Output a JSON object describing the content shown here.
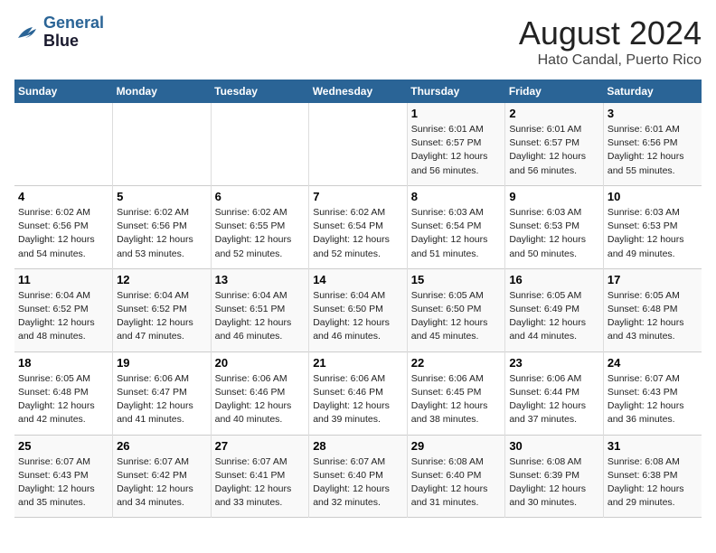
{
  "header": {
    "logo_line1": "General",
    "logo_line2": "Blue",
    "month": "August 2024",
    "location": "Hato Candal, Puerto Rico"
  },
  "weekdays": [
    "Sunday",
    "Monday",
    "Tuesday",
    "Wednesday",
    "Thursday",
    "Friday",
    "Saturday"
  ],
  "weeks": [
    [
      {
        "day": "",
        "info": ""
      },
      {
        "day": "",
        "info": ""
      },
      {
        "day": "",
        "info": ""
      },
      {
        "day": "",
        "info": ""
      },
      {
        "day": "1",
        "info": "Sunrise: 6:01 AM\nSunset: 6:57 PM\nDaylight: 12 hours\nand 56 minutes."
      },
      {
        "day": "2",
        "info": "Sunrise: 6:01 AM\nSunset: 6:57 PM\nDaylight: 12 hours\nand 56 minutes."
      },
      {
        "day": "3",
        "info": "Sunrise: 6:01 AM\nSunset: 6:56 PM\nDaylight: 12 hours\nand 55 minutes."
      }
    ],
    [
      {
        "day": "4",
        "info": "Sunrise: 6:02 AM\nSunset: 6:56 PM\nDaylight: 12 hours\nand 54 minutes."
      },
      {
        "day": "5",
        "info": "Sunrise: 6:02 AM\nSunset: 6:56 PM\nDaylight: 12 hours\nand 53 minutes."
      },
      {
        "day": "6",
        "info": "Sunrise: 6:02 AM\nSunset: 6:55 PM\nDaylight: 12 hours\nand 52 minutes."
      },
      {
        "day": "7",
        "info": "Sunrise: 6:02 AM\nSunset: 6:54 PM\nDaylight: 12 hours\nand 52 minutes."
      },
      {
        "day": "8",
        "info": "Sunrise: 6:03 AM\nSunset: 6:54 PM\nDaylight: 12 hours\nand 51 minutes."
      },
      {
        "day": "9",
        "info": "Sunrise: 6:03 AM\nSunset: 6:53 PM\nDaylight: 12 hours\nand 50 minutes."
      },
      {
        "day": "10",
        "info": "Sunrise: 6:03 AM\nSunset: 6:53 PM\nDaylight: 12 hours\nand 49 minutes."
      }
    ],
    [
      {
        "day": "11",
        "info": "Sunrise: 6:04 AM\nSunset: 6:52 PM\nDaylight: 12 hours\nand 48 minutes."
      },
      {
        "day": "12",
        "info": "Sunrise: 6:04 AM\nSunset: 6:52 PM\nDaylight: 12 hours\nand 47 minutes."
      },
      {
        "day": "13",
        "info": "Sunrise: 6:04 AM\nSunset: 6:51 PM\nDaylight: 12 hours\nand 46 minutes."
      },
      {
        "day": "14",
        "info": "Sunrise: 6:04 AM\nSunset: 6:50 PM\nDaylight: 12 hours\nand 46 minutes."
      },
      {
        "day": "15",
        "info": "Sunrise: 6:05 AM\nSunset: 6:50 PM\nDaylight: 12 hours\nand 45 minutes."
      },
      {
        "day": "16",
        "info": "Sunrise: 6:05 AM\nSunset: 6:49 PM\nDaylight: 12 hours\nand 44 minutes."
      },
      {
        "day": "17",
        "info": "Sunrise: 6:05 AM\nSunset: 6:48 PM\nDaylight: 12 hours\nand 43 minutes."
      }
    ],
    [
      {
        "day": "18",
        "info": "Sunrise: 6:05 AM\nSunset: 6:48 PM\nDaylight: 12 hours\nand 42 minutes."
      },
      {
        "day": "19",
        "info": "Sunrise: 6:06 AM\nSunset: 6:47 PM\nDaylight: 12 hours\nand 41 minutes."
      },
      {
        "day": "20",
        "info": "Sunrise: 6:06 AM\nSunset: 6:46 PM\nDaylight: 12 hours\nand 40 minutes."
      },
      {
        "day": "21",
        "info": "Sunrise: 6:06 AM\nSunset: 6:46 PM\nDaylight: 12 hours\nand 39 minutes."
      },
      {
        "day": "22",
        "info": "Sunrise: 6:06 AM\nSunset: 6:45 PM\nDaylight: 12 hours\nand 38 minutes."
      },
      {
        "day": "23",
        "info": "Sunrise: 6:06 AM\nSunset: 6:44 PM\nDaylight: 12 hours\nand 37 minutes."
      },
      {
        "day": "24",
        "info": "Sunrise: 6:07 AM\nSunset: 6:43 PM\nDaylight: 12 hours\nand 36 minutes."
      }
    ],
    [
      {
        "day": "25",
        "info": "Sunrise: 6:07 AM\nSunset: 6:43 PM\nDaylight: 12 hours\nand 35 minutes."
      },
      {
        "day": "26",
        "info": "Sunrise: 6:07 AM\nSunset: 6:42 PM\nDaylight: 12 hours\nand 34 minutes."
      },
      {
        "day": "27",
        "info": "Sunrise: 6:07 AM\nSunset: 6:41 PM\nDaylight: 12 hours\nand 33 minutes."
      },
      {
        "day": "28",
        "info": "Sunrise: 6:07 AM\nSunset: 6:40 PM\nDaylight: 12 hours\nand 32 minutes."
      },
      {
        "day": "29",
        "info": "Sunrise: 6:08 AM\nSunset: 6:40 PM\nDaylight: 12 hours\nand 31 minutes."
      },
      {
        "day": "30",
        "info": "Sunrise: 6:08 AM\nSunset: 6:39 PM\nDaylight: 12 hours\nand 30 minutes."
      },
      {
        "day": "31",
        "info": "Sunrise: 6:08 AM\nSunset: 6:38 PM\nDaylight: 12 hours\nand 29 minutes."
      }
    ]
  ]
}
